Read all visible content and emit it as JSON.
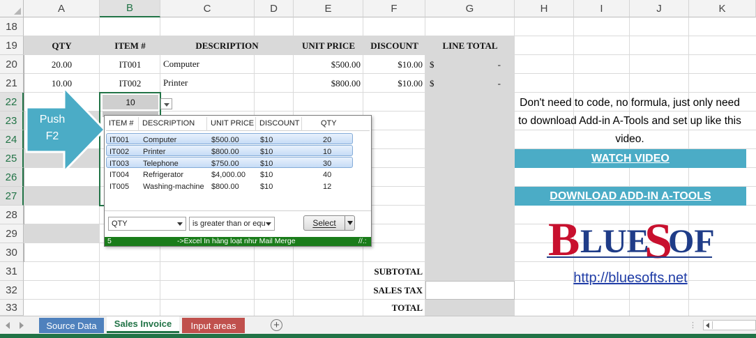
{
  "columns": [
    "A",
    "B",
    "C",
    "D",
    "E",
    "F",
    "G",
    "H",
    "I",
    "J",
    "K"
  ],
  "rows": [
    "18",
    "19",
    "20",
    "21",
    "22",
    "23",
    "24",
    "25",
    "26",
    "27",
    "28",
    "29",
    "30",
    "31",
    "32",
    "33"
  ],
  "invoice_headers": {
    "qty": "QTY",
    "item": "ITEM #",
    "description": "DESCRIPTION",
    "unit_price": "UNIT PRICE",
    "discount": "DISCOUNT",
    "line_total": "LINE TOTAL"
  },
  "line_items": [
    {
      "qty": "20.00",
      "item": "IT001",
      "description": "Computer",
      "unit_price": "$500.00",
      "discount": "$10.00",
      "currency": "$",
      "total": "-"
    },
    {
      "qty": "10.00",
      "item": "IT002",
      "description": "Printer",
      "unit_price": "$800.00",
      "discount": "$10.00",
      "currency": "$",
      "total": "-"
    }
  ],
  "active_cell_value": "10",
  "callout": {
    "line1": "Push",
    "line2": "F2"
  },
  "totals": {
    "subtotal": "SUBTOTAL",
    "sales_tax": "SALES TAX",
    "total": "TOTAL"
  },
  "popup": {
    "headers": {
      "item": "ITEM #",
      "description": "DESCRIPTION",
      "unit_price": "UNIT PRICE",
      "discount": "DISCOUNT",
      "qty": "QTY"
    },
    "rows": [
      {
        "item": "IT001",
        "description": "Computer",
        "unit_price": "$500.00",
        "discount": "$10",
        "qty": "20",
        "highlight": true
      },
      {
        "item": "IT002",
        "description": "Printer",
        "unit_price": "$800.00",
        "discount": "$10",
        "qty": "10",
        "highlight": true
      },
      {
        "item": "IT003",
        "description": "Telephone",
        "unit_price": "$750.00",
        "discount": "$10",
        "qty": "30",
        "highlight": true
      },
      {
        "item": "IT004",
        "description": "Refrigerator",
        "unit_price": "$4,000.00",
        "discount": "$10",
        "qty": "40",
        "highlight": false
      },
      {
        "item": "IT005",
        "description": "Washing-machine",
        "unit_price": "$800.00",
        "discount": "$10",
        "qty": "12",
        "highlight": false
      }
    ],
    "filter_field": "QTY",
    "filter_operator": "is greater than or equ",
    "select_label": "Select",
    "status_count": "5",
    "status_text": "->Excel In hàng loạt như Mail Merge",
    "status_end": "//.:"
  },
  "promo": {
    "text": "Don't need to code, no formula, just only need to download Add-in A-Tools and set up like this video.",
    "watch_video": "WATCH VIDEO",
    "download": "DOWNLOAD ADD-IN A-TOOLS",
    "logo": "BLUESOFTS",
    "url": "http://bluesofts.net"
  },
  "sheet_tabs": [
    {
      "label": "Source Data",
      "color": "#4f81bd"
    },
    {
      "label": "Sales Invoice",
      "color": "#ffffff",
      "active": true
    },
    {
      "label": "Input areas",
      "color": "#c0504d"
    }
  ],
  "colors": {
    "accent": "#217346",
    "teal": "#4bacc6",
    "header_gray": "#d9d9d9",
    "callout": "#4bacc6"
  }
}
